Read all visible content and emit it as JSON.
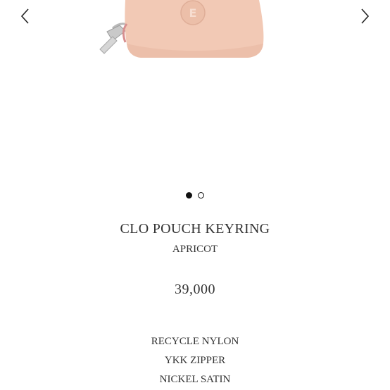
{
  "product": {
    "name": "CLO POUCH KEYRING",
    "color": "APRICOT",
    "price": "39,000",
    "materials": [
      "RECYCLE NYLON",
      "YKK ZIPPER",
      "NICKEL SATIN"
    ]
  },
  "gallery": {
    "image_count": 2,
    "active_index": 0,
    "prev_icon": "chevron-left-icon",
    "next_icon": "chevron-right-icon",
    "logo_letter": "E"
  },
  "colors": {
    "pouch": "#f2c9b5",
    "pouch_shade": "#e7b6a0",
    "hardware": "#b9b9b9",
    "text": "#333333",
    "dot": "#111111"
  }
}
